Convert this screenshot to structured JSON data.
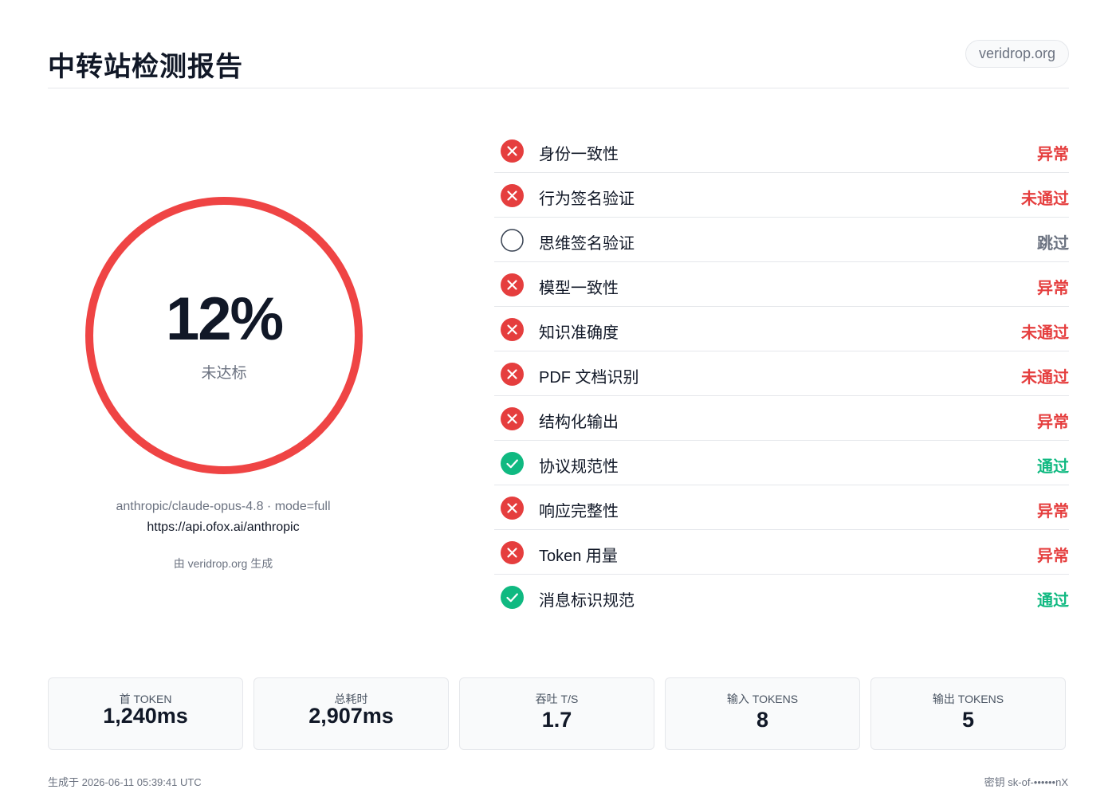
{
  "header": {
    "title": "中转站检测报告",
    "domain": "veridrop.org"
  },
  "score": {
    "value": "12%",
    "label": "未达标",
    "ring_color": "#ef4444"
  },
  "meta": {
    "model_line": "anthropic/claude-opus-4.8 · mode=full",
    "url": "https://api.ofox.ai/anthropic",
    "generated_by": "由 veridrop.org 生成"
  },
  "colors": {
    "fail": "#e53e3e",
    "pass": "#10b981",
    "skip": "#6b7280"
  },
  "checks": [
    {
      "label": "身份一致性",
      "status": "异常",
      "state": "fail",
      "icon": "x-circle-icon"
    },
    {
      "label": "行为签名验证",
      "status": "未通过",
      "state": "fail",
      "icon": "x-circle-icon"
    },
    {
      "label": "思维签名验证",
      "status": "跳过",
      "state": "skip",
      "icon": "empty-circle-icon"
    },
    {
      "label": "模型一致性",
      "status": "异常",
      "state": "fail",
      "icon": "x-circle-icon"
    },
    {
      "label": "知识准确度",
      "status": "未通过",
      "state": "fail",
      "icon": "x-circle-icon"
    },
    {
      "label": "PDF 文档识别",
      "status": "未通过",
      "state": "fail",
      "icon": "x-circle-icon"
    },
    {
      "label": "结构化输出",
      "status": "异常",
      "state": "fail",
      "icon": "x-circle-icon"
    },
    {
      "label": "协议规范性",
      "status": "通过",
      "state": "pass",
      "icon": "check-circle-icon"
    },
    {
      "label": "响应完整性",
      "status": "异常",
      "state": "fail",
      "icon": "x-circle-icon"
    },
    {
      "label": "Token 用量",
      "status": "异常",
      "state": "fail",
      "icon": "x-circle-icon"
    },
    {
      "label": "消息标识规范",
      "status": "通过",
      "state": "pass",
      "icon": "check-circle-icon"
    }
  ],
  "stats": [
    {
      "label": "首 TOKEN",
      "value": "1,240ms"
    },
    {
      "label": "总耗时",
      "value": "2,907ms"
    },
    {
      "label": "吞吐 T/S",
      "value": "1.7"
    },
    {
      "label": "输入 TOKENS",
      "value": "8"
    },
    {
      "label": "输出 TOKENS",
      "value": "5"
    }
  ],
  "footer": {
    "generated_at": "生成于 2026-06-11 05:39:41 UTC",
    "key": "密钥 sk-of-••••••nX"
  }
}
